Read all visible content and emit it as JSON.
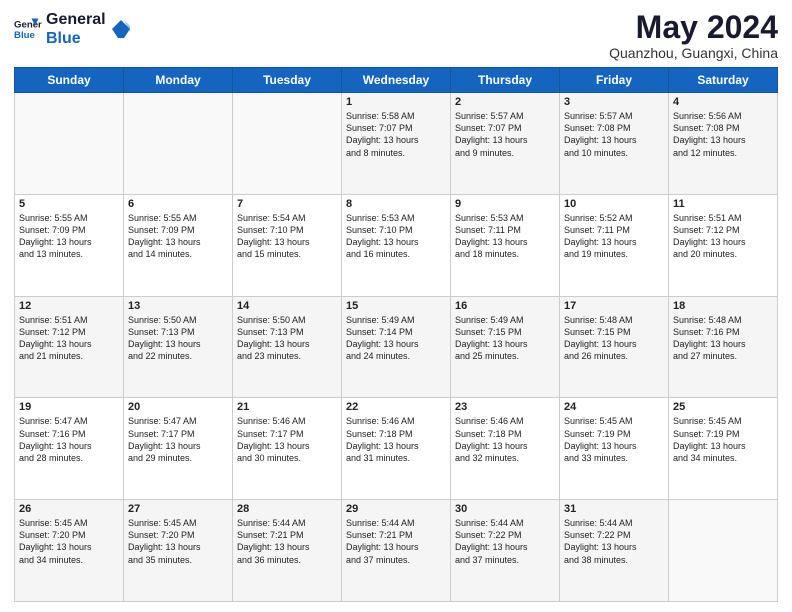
{
  "header": {
    "logo_line1": "General",
    "logo_line2": "Blue",
    "month_year": "May 2024",
    "location": "Quanzhou, Guangxi, China"
  },
  "days_of_week": [
    "Sunday",
    "Monday",
    "Tuesday",
    "Wednesday",
    "Thursday",
    "Friday",
    "Saturday"
  ],
  "weeks": [
    [
      {
        "day": "",
        "info": ""
      },
      {
        "day": "",
        "info": ""
      },
      {
        "day": "",
        "info": ""
      },
      {
        "day": "1",
        "info": "Sunrise: 5:58 AM\nSunset: 7:07 PM\nDaylight: 13 hours\nand 8 minutes."
      },
      {
        "day": "2",
        "info": "Sunrise: 5:57 AM\nSunset: 7:07 PM\nDaylight: 13 hours\nand 9 minutes."
      },
      {
        "day": "3",
        "info": "Sunrise: 5:57 AM\nSunset: 7:08 PM\nDaylight: 13 hours\nand 10 minutes."
      },
      {
        "day": "4",
        "info": "Sunrise: 5:56 AM\nSunset: 7:08 PM\nDaylight: 13 hours\nand 12 minutes."
      }
    ],
    [
      {
        "day": "5",
        "info": "Sunrise: 5:55 AM\nSunset: 7:09 PM\nDaylight: 13 hours\nand 13 minutes."
      },
      {
        "day": "6",
        "info": "Sunrise: 5:55 AM\nSunset: 7:09 PM\nDaylight: 13 hours\nand 14 minutes."
      },
      {
        "day": "7",
        "info": "Sunrise: 5:54 AM\nSunset: 7:10 PM\nDaylight: 13 hours\nand 15 minutes."
      },
      {
        "day": "8",
        "info": "Sunrise: 5:53 AM\nSunset: 7:10 PM\nDaylight: 13 hours\nand 16 minutes."
      },
      {
        "day": "9",
        "info": "Sunrise: 5:53 AM\nSunset: 7:11 PM\nDaylight: 13 hours\nand 18 minutes."
      },
      {
        "day": "10",
        "info": "Sunrise: 5:52 AM\nSunset: 7:11 PM\nDaylight: 13 hours\nand 19 minutes."
      },
      {
        "day": "11",
        "info": "Sunrise: 5:51 AM\nSunset: 7:12 PM\nDaylight: 13 hours\nand 20 minutes."
      }
    ],
    [
      {
        "day": "12",
        "info": "Sunrise: 5:51 AM\nSunset: 7:12 PM\nDaylight: 13 hours\nand 21 minutes."
      },
      {
        "day": "13",
        "info": "Sunrise: 5:50 AM\nSunset: 7:13 PM\nDaylight: 13 hours\nand 22 minutes."
      },
      {
        "day": "14",
        "info": "Sunrise: 5:50 AM\nSunset: 7:13 PM\nDaylight: 13 hours\nand 23 minutes."
      },
      {
        "day": "15",
        "info": "Sunrise: 5:49 AM\nSunset: 7:14 PM\nDaylight: 13 hours\nand 24 minutes."
      },
      {
        "day": "16",
        "info": "Sunrise: 5:49 AM\nSunset: 7:15 PM\nDaylight: 13 hours\nand 25 minutes."
      },
      {
        "day": "17",
        "info": "Sunrise: 5:48 AM\nSunset: 7:15 PM\nDaylight: 13 hours\nand 26 minutes."
      },
      {
        "day": "18",
        "info": "Sunrise: 5:48 AM\nSunset: 7:16 PM\nDaylight: 13 hours\nand 27 minutes."
      }
    ],
    [
      {
        "day": "19",
        "info": "Sunrise: 5:47 AM\nSunset: 7:16 PM\nDaylight: 13 hours\nand 28 minutes."
      },
      {
        "day": "20",
        "info": "Sunrise: 5:47 AM\nSunset: 7:17 PM\nDaylight: 13 hours\nand 29 minutes."
      },
      {
        "day": "21",
        "info": "Sunrise: 5:46 AM\nSunset: 7:17 PM\nDaylight: 13 hours\nand 30 minutes."
      },
      {
        "day": "22",
        "info": "Sunrise: 5:46 AM\nSunset: 7:18 PM\nDaylight: 13 hours\nand 31 minutes."
      },
      {
        "day": "23",
        "info": "Sunrise: 5:46 AM\nSunset: 7:18 PM\nDaylight: 13 hours\nand 32 minutes."
      },
      {
        "day": "24",
        "info": "Sunrise: 5:45 AM\nSunset: 7:19 PM\nDaylight: 13 hours\nand 33 minutes."
      },
      {
        "day": "25",
        "info": "Sunrise: 5:45 AM\nSunset: 7:19 PM\nDaylight: 13 hours\nand 34 minutes."
      }
    ],
    [
      {
        "day": "26",
        "info": "Sunrise: 5:45 AM\nSunset: 7:20 PM\nDaylight: 13 hours\nand 34 minutes."
      },
      {
        "day": "27",
        "info": "Sunrise: 5:45 AM\nSunset: 7:20 PM\nDaylight: 13 hours\nand 35 minutes."
      },
      {
        "day": "28",
        "info": "Sunrise: 5:44 AM\nSunset: 7:21 PM\nDaylight: 13 hours\nand 36 minutes."
      },
      {
        "day": "29",
        "info": "Sunrise: 5:44 AM\nSunset: 7:21 PM\nDaylight: 13 hours\nand 37 minutes."
      },
      {
        "day": "30",
        "info": "Sunrise: 5:44 AM\nSunset: 7:22 PM\nDaylight: 13 hours\nand 37 minutes."
      },
      {
        "day": "31",
        "info": "Sunrise: 5:44 AM\nSunset: 7:22 PM\nDaylight: 13 hours\nand 38 minutes."
      },
      {
        "day": "",
        "info": ""
      }
    ]
  ]
}
